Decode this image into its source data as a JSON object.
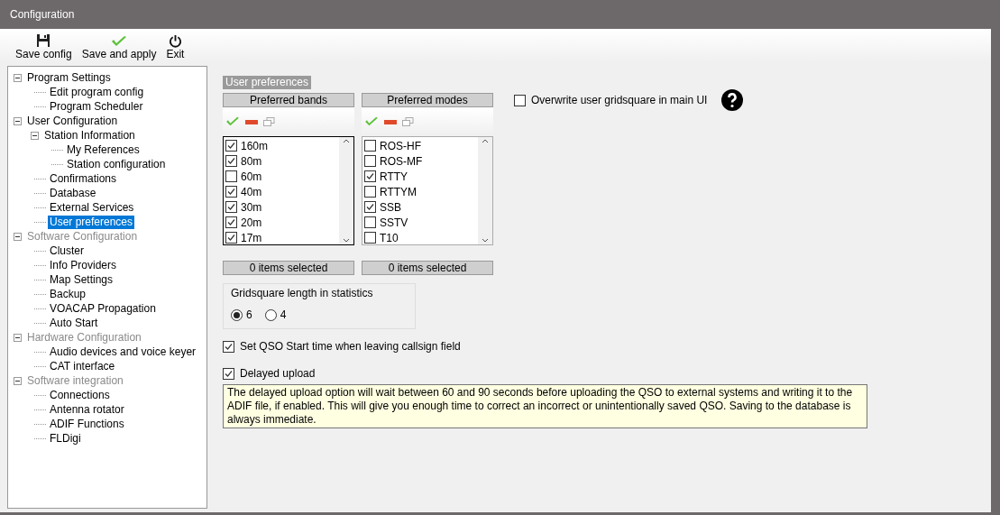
{
  "window": {
    "title": "Configuration"
  },
  "toolbar": [
    {
      "kind": "save",
      "label": "Save config"
    },
    {
      "kind": "apply",
      "label": "Save and apply"
    },
    {
      "kind": "exit",
      "label": "Exit"
    }
  ],
  "tree": [
    {
      "label": "Program Settings",
      "selected": false,
      "disabled": false,
      "expanded": true,
      "children": [
        {
          "label": "Edit program config",
          "selected": false
        },
        {
          "label": "Program Scheduler",
          "selected": false
        }
      ]
    },
    {
      "label": "User Configuration",
      "selected": false,
      "disabled": false,
      "expanded": true,
      "children": [
        {
          "label": "Station Information",
          "selected": false,
          "expanded": true,
          "children": [
            {
              "label": "My References",
              "selected": false
            },
            {
              "label": "Station configuration",
              "selected": false
            }
          ]
        },
        {
          "label": "Confirmations",
          "selected": false
        },
        {
          "label": "Database",
          "selected": false
        },
        {
          "label": "External Services",
          "selected": false
        },
        {
          "label": "User preferences",
          "selected": true
        }
      ]
    },
    {
      "label": "Software Configuration",
      "selected": false,
      "disabled": true,
      "expanded": true,
      "children": [
        {
          "label": "Cluster",
          "selected": false
        },
        {
          "label": "Info Providers",
          "selected": false
        },
        {
          "label": "Map Settings",
          "selected": false
        },
        {
          "label": "Backup",
          "selected": false
        },
        {
          "label": "VOACAP Propagation",
          "selected": false
        },
        {
          "label": "Auto Start",
          "selected": false
        }
      ]
    },
    {
      "label": "Hardware Configuration",
      "selected": false,
      "disabled": true,
      "expanded": true,
      "children": [
        {
          "label": "Audio devices and voice keyer",
          "selected": false
        },
        {
          "label": "CAT interface",
          "selected": false
        }
      ]
    },
    {
      "label": "Software integration",
      "selected": false,
      "disabled": true,
      "expanded": true,
      "children": [
        {
          "label": "Connections",
          "selected": false
        },
        {
          "label": "Antenna rotator",
          "selected": false
        },
        {
          "label": "ADIF Functions",
          "selected": false
        },
        {
          "label": "FLDigi",
          "selected": false
        }
      ]
    }
  ],
  "section_title": "User preferences",
  "lists": [
    {
      "header": "Preferred bands",
      "footer": "0 items selected",
      "focused": true,
      "items": [
        {
          "label": "160m",
          "checked": true
        },
        {
          "label": "80m",
          "checked": true
        },
        {
          "label": "60m",
          "checked": false
        },
        {
          "label": "40m",
          "checked": true
        },
        {
          "label": "30m",
          "checked": true
        },
        {
          "label": "20m",
          "checked": true
        },
        {
          "label": "17m",
          "checked": true
        }
      ]
    },
    {
      "header": "Preferred modes",
      "footer": "0 items selected",
      "focused": false,
      "items": [
        {
          "label": "ROS-HF",
          "checked": false
        },
        {
          "label": "ROS-MF",
          "checked": false
        },
        {
          "label": "RTTY",
          "checked": true
        },
        {
          "label": "RTTYM",
          "checked": false
        },
        {
          "label": "SSB",
          "checked": true
        },
        {
          "label": "SSTV",
          "checked": false
        },
        {
          "label": "T10",
          "checked": false
        }
      ]
    }
  ],
  "overwrite_gridsquare": {
    "label": "Overwrite user gridsquare in main UI",
    "checked": false
  },
  "gridsquare_group": {
    "title": "Gridsquare length in statistics",
    "options": [
      {
        "label": "6",
        "selected": true
      },
      {
        "label": "4",
        "selected": false
      }
    ]
  },
  "set_qso_start": {
    "label": "Set QSO Start time when leaving callsign field",
    "checked": true
  },
  "delayed_upload": {
    "label": "Delayed upload",
    "checked": true
  },
  "info_note": "The delayed upload option will wait between 60 and 90 seconds before uploading the QSO to external systems and writing it to the ADIF file, if enabled. This will give you enough time to correct an incorrect or unintentionally saved QSO. Saving to the database is always immediate."
}
